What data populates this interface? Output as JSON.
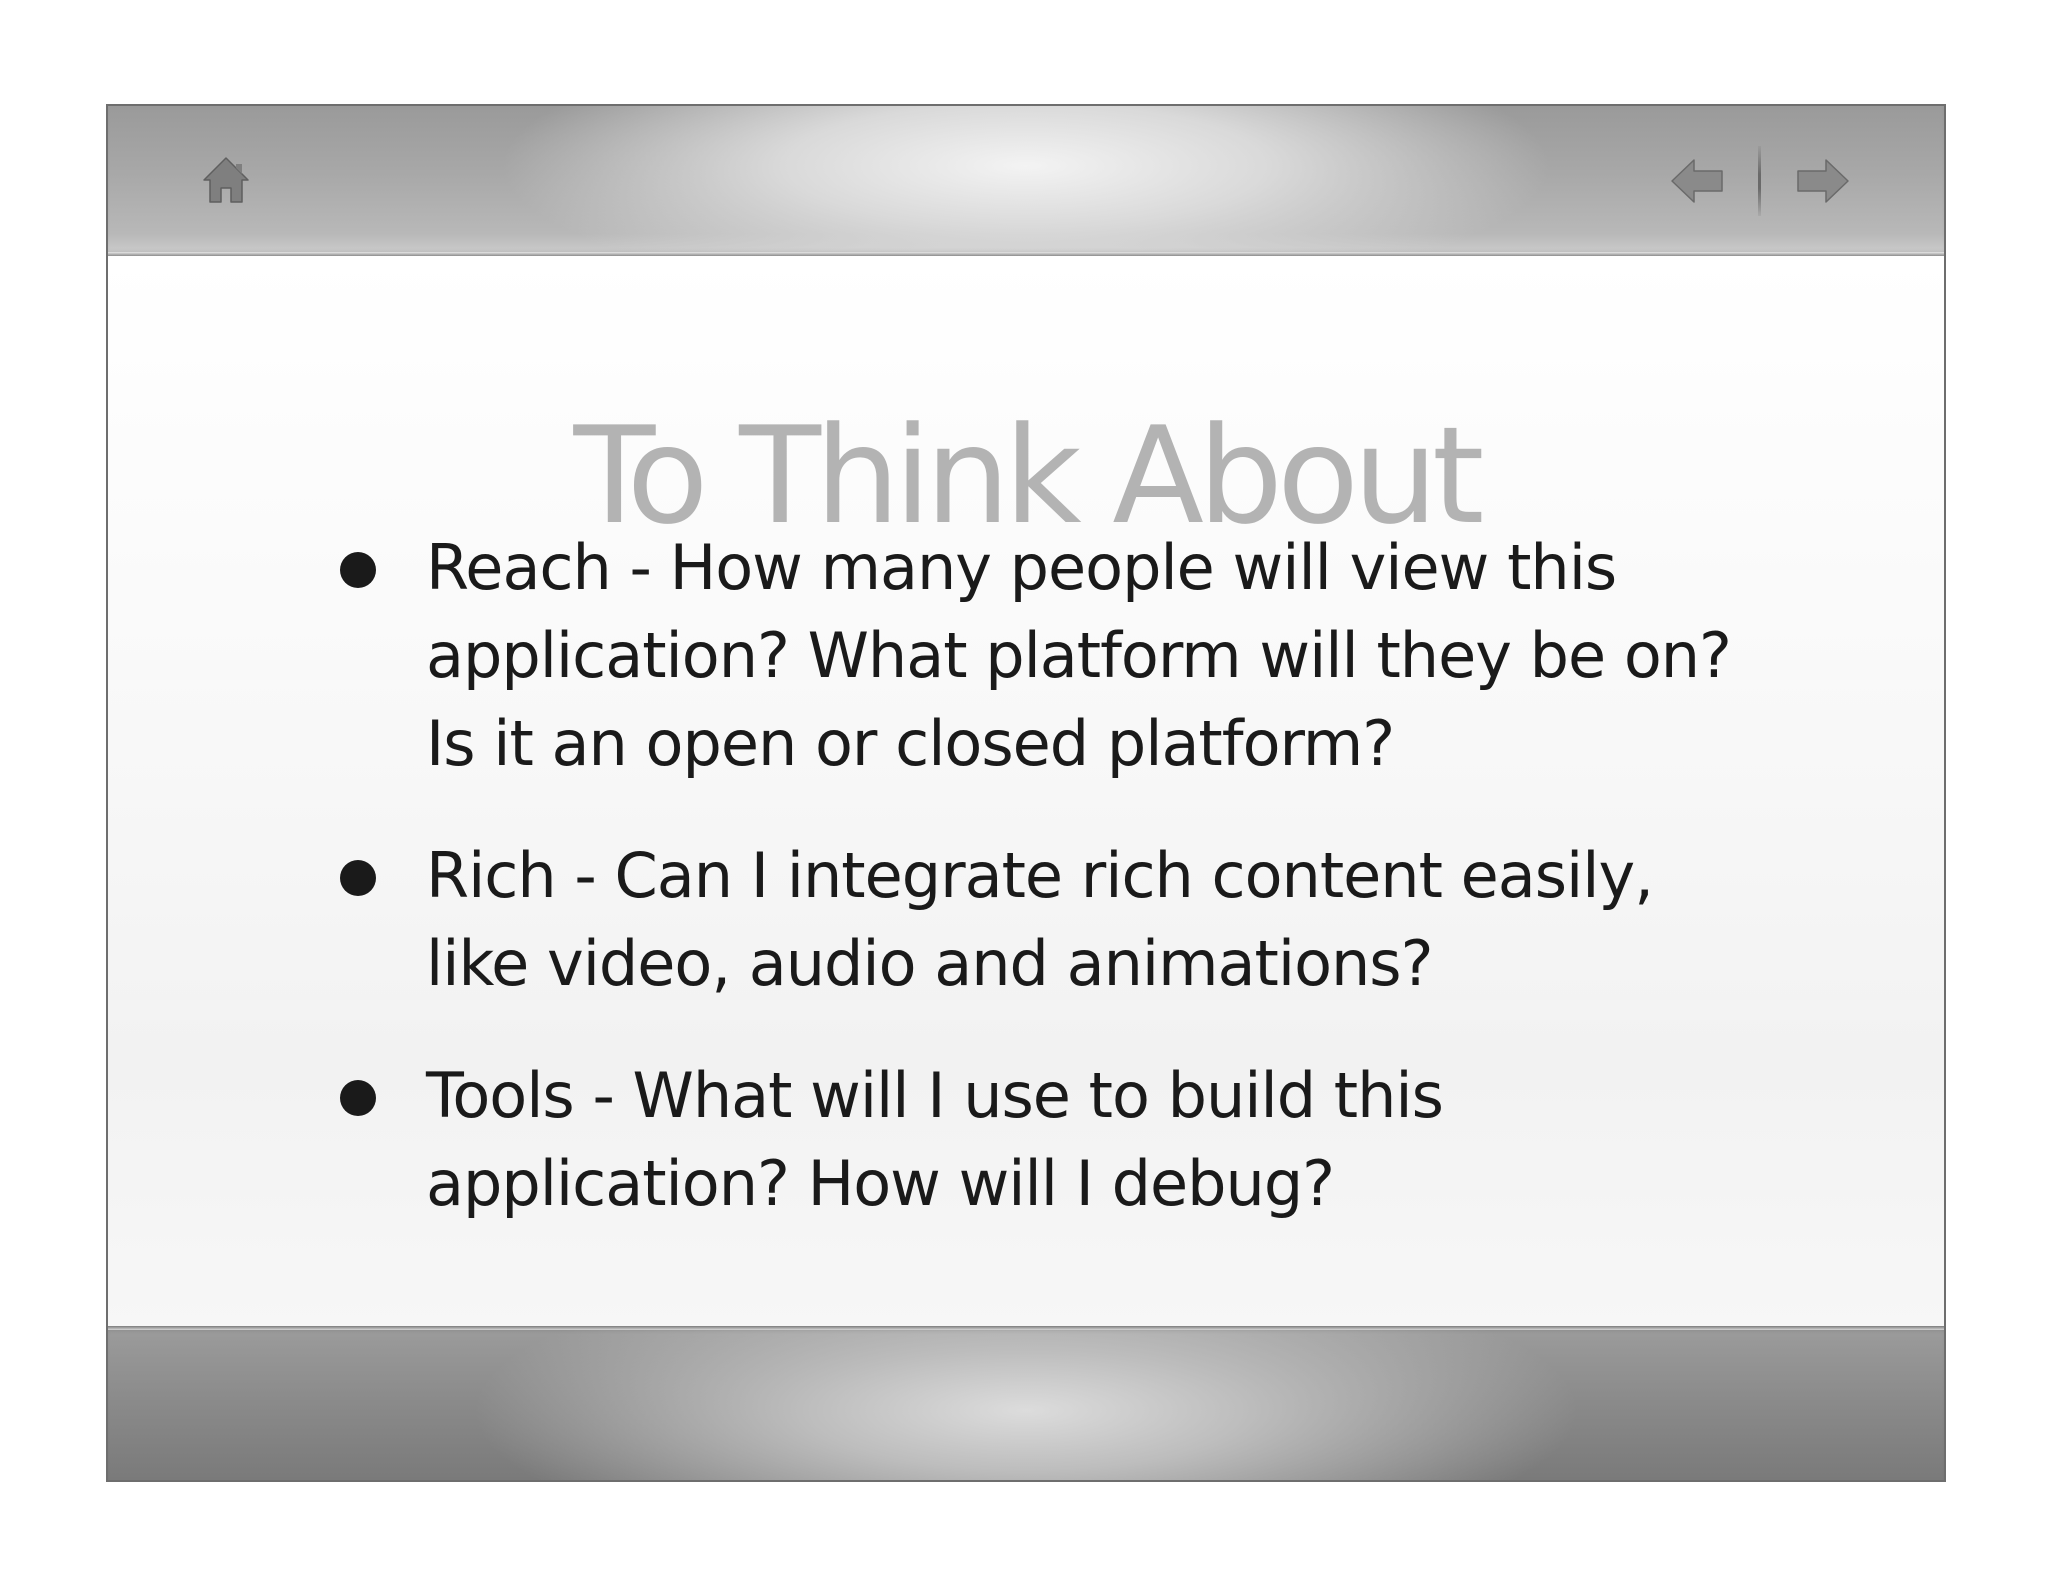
{
  "toolbar": {
    "home_icon": "home-icon",
    "prev_icon": "arrow-left-icon",
    "next_icon": "arrow-right-icon"
  },
  "slide": {
    "title": "To Think About",
    "bullets": [
      {
        "lines": [
          "Reach - How many people will view this",
          "application?  What platform will they be on?",
          "Is it an open or closed platform?"
        ]
      },
      {
        "lines": [
          "Rich - Can I integrate rich content easily,",
          "like video, audio and animations?"
        ]
      },
      {
        "lines": [
          "Tools - What will I use to build this",
          "application?  How will I debug?"
        ]
      }
    ]
  },
  "colors": {
    "title": "#b3b3b3",
    "text": "#1a1a1a",
    "icon": "#7a7a7a"
  }
}
